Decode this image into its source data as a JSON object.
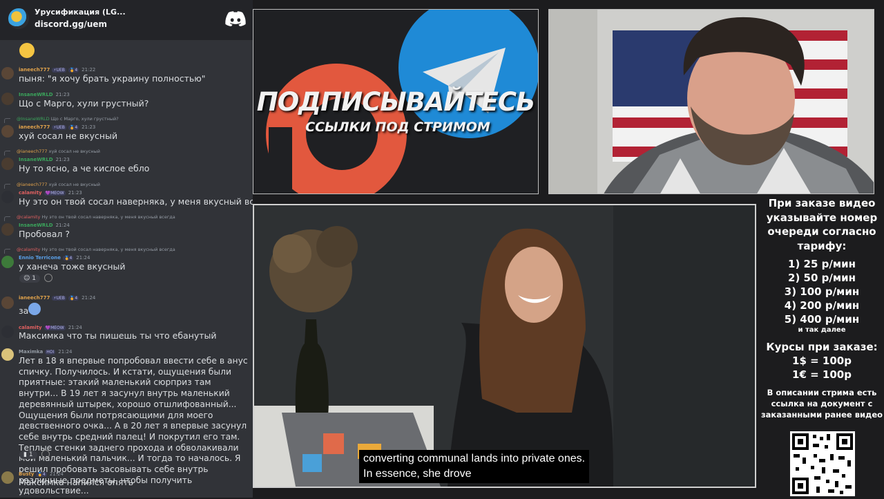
{
  "server": {
    "name": "Урусификация (LG...",
    "invite": "discord.gg/uem"
  },
  "messages": [
    {
      "author": "ianeech777",
      "author_color": "#e0a24b",
      "badges": [
        "⚡UEB",
        "🏅4"
      ],
      "time": "21:22",
      "text": "пыня: \"я хочу брать украину полностью\""
    },
    {
      "author": "InsaneWRLD",
      "author_color": "#3ba55c",
      "badges": [],
      "time": "21:23",
      "text": "Що с Марго, хули грустный?"
    },
    {
      "reply_author": "@InsaneWRLD",
      "reply_text": "Що с Марго, хули грустный?",
      "author": "ianeech777",
      "author_color": "#e0a24b",
      "badges": [
        "⚡UEB",
        "🏅4"
      ],
      "time": "21:23",
      "text": "хуй сосал не вкусный"
    },
    {
      "reply_author": "@ianeech777",
      "reply_text": "хуй сосал не вкусный",
      "author": "InsaneWRLD",
      "author_color": "#3ba55c",
      "badges": [],
      "time": "21:23",
      "text": "Ну то ясно, а че кислое ебло"
    },
    {
      "reply_author": "@ianeech777",
      "reply_text": "хуй сосал не вкусный",
      "author": "calamity",
      "author_color": "#e06060",
      "badges": [
        "💜MEOW"
      ],
      "time": "21:23",
      "text": "Ну это он твой сосал наверняка, у меня вкусный всегда"
    },
    {
      "reply_author": "@calamity",
      "reply_text": "Ну это он твой сосал наверняка, у меня вкусный всегда",
      "author": "InsaneWRLD",
      "author_color": "#3ba55c",
      "badges": [],
      "time": "21:24",
      "text": "Пробовал ?"
    },
    {
      "reply_author": "@calamity",
      "reply_text": "Ну это он твой сосал наверняка, у меня вкусный всегда",
      "author": "Ennio Terricone",
      "author_color": "#5aa0e8",
      "badges": [
        "🏅4"
      ],
      "time": "21:24",
      "text": "у ханеча тоже вкусный",
      "reaction": "1"
    },
    {
      "author": "ianeech777",
      "author_color": "#e0a24b",
      "badges": [
        "⚡UEB",
        "🏅4"
      ],
      "time": "21:24",
      "text": "за"
    },
    {
      "author": "calamity",
      "author_color": "#e06060",
      "badges": [
        "💜MEOW"
      ],
      "time": "21:24",
      "text": "Максимка что ты пишешь ты что ебанутый"
    },
    {
      "author": "Maximka",
      "author_color": "#949ba4",
      "badges": [
        "HOI"
      ],
      "time": "21:24",
      "text": "Лет в 18 я впервые попробовал ввести себе в анус спичку. Получилось. И кстати, ощущения были приятные: этакий маленький сюрприз там внутри... В 19 лет я засунул внутрь маленький деревянный штырек, хорошо отшлифованный... Ощущения были потрясающими для моего девственного очка... А в 20 лет я впервые засунул себе внутрь средний палец! И покрутил его там. Теплые стенки заднего прохода и обволакивали мой маленький пальчик... И тогда то началось. Я решил пробовать засовывать себе внутрь различные предметы, чтобы получить удовольствие...",
      "reaction": "1"
    },
    {
      "author": "Busty",
      "author_color": "#e0a24b",
      "badges": [
        "🏅4"
      ],
      "time": "21:24",
      "text": "Максимка напился опять"
    }
  ],
  "banner": {
    "title": "ПОДПИСЫВАЙТЕСЬ",
    "subtitle": "ССЫЛКИ ПОД СТРИМОМ"
  },
  "subtitles": {
    "line1": "converting communal lands into private ones.",
    "line2": "In essence, she drove"
  },
  "info": {
    "heading": "При заказе видео указывайте номер очереди согласно тарифу:",
    "tiers": [
      "1) 25 р/мин",
      "2) 50 р/мин",
      "3) 100 р/мин",
      "4) 200 р/мин",
      "5) 400 р/мин"
    ],
    "etc": "и так далее",
    "courses_title": "Курсы при заказе:",
    "rate_usd": "1$ = 100р",
    "rate_eur": "1€ = 100р",
    "description": "В описании стрима есть ссылка на документ с заказанными ранее видео"
  },
  "colors": {
    "chat_bg": "#313338",
    "chat_header_bg": "#232428",
    "page_bg": "#1c1c1e"
  }
}
